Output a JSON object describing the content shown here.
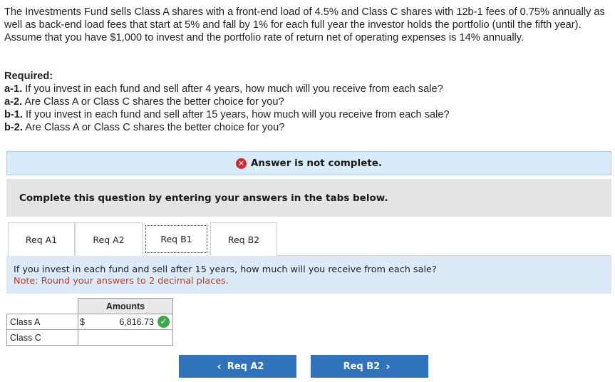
{
  "problem": {
    "text": "The Investments Fund sells Class A shares with a front-end load of 4.5% and Class C shares with 12b-1 fees of 0.75% annually as well as back-end load fees that start at 5% and fall by 1% for each full year the investor holds the portfolio (until the fifth year). Assume that you have $1,000 to invest and the portfolio rate of return net of operating expenses is 14% annually."
  },
  "required": {
    "title": "Required:",
    "items": [
      {
        "key": "a-1.",
        "text": " If you invest in each fund and sell after 4 years, how much will you receive from each sale?"
      },
      {
        "key": "a-2.",
        "text": " Are Class A or Class C shares the better choice for you?"
      },
      {
        "key": "b-1.",
        "text": " If you invest in each fund and sell after 15 years, how much will you receive from each sale?"
      },
      {
        "key": "b-2.",
        "text": " Are Class A or Class C shares the better choice for you?"
      }
    ]
  },
  "banner": {
    "text": "Answer is not complete.",
    "icon": "x-circle-icon",
    "icon_color": "#d6262b"
  },
  "instruction": {
    "text": "Complete this question by entering your answers in the tabs below."
  },
  "tabs": [
    {
      "label": "Req A1",
      "active": false
    },
    {
      "label": "Req A2",
      "active": false
    },
    {
      "label": "Req B1",
      "active": true
    },
    {
      "label": "Req B2",
      "active": false
    }
  ],
  "panel": {
    "question": "If you invest in each fund and sell after 15 years, how much will you receive from each sale?",
    "note": "Note: Round your answers to 2 decimal places."
  },
  "table": {
    "header": "Amounts",
    "rows": [
      {
        "label": "Class A",
        "currency": "$",
        "value": "6,816.73",
        "correct": true
      },
      {
        "label": "Class C",
        "currency": "",
        "value": "",
        "correct": false
      }
    ]
  },
  "nav": {
    "prev_label": "Req A2",
    "next_label": "Req B2",
    "button_color": "#2f73bd"
  }
}
